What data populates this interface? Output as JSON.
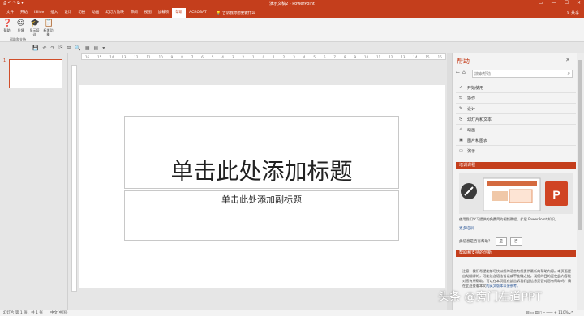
{
  "colors": {
    "accent": "#c43e1c",
    "link": "#2b5797"
  },
  "titlebar": {
    "title": "演示文稿2 - PowerPoint",
    "qat": "⎙ ↶ ↷ ⧉ ▾",
    "controls": [
      "▭",
      "—",
      "☐",
      "✕"
    ]
  },
  "tabs": [
    "文件",
    "开始",
    "iSlide",
    "插入",
    "设计",
    "切换",
    "动画",
    "幻灯片放映",
    "审阅",
    "视图",
    "加载项",
    "帮助",
    "ACROBAT"
  ],
  "active_tab_index": 11,
  "tellme": {
    "icon": "lightbulb-icon",
    "label": "告诉我你想要做什么"
  },
  "share": "⇪ 共享",
  "ribbon": {
    "buttons": [
      {
        "icon": "help-icon",
        "glyph": "❓",
        "label": "帮助"
      },
      {
        "icon": "feedback-icon",
        "glyph": "☺",
        "label": "反馈"
      },
      {
        "icon": "training-icon",
        "glyph": "🎓",
        "label": "显示培训"
      },
      {
        "icon": "whatsnew-icon",
        "glyph": "📋",
        "label": "新增功能"
      }
    ],
    "group_label": "帮助和支持"
  },
  "quick_access": [
    "💾",
    "↶",
    "↷",
    "⎘",
    "⊞",
    "🔍",
    "▦",
    "▤",
    "▾"
  ],
  "ruler_ticks": [
    "16",
    "15",
    "14",
    "13",
    "12",
    "11",
    "10",
    "9",
    "8",
    "7",
    "6",
    "5",
    "4",
    "3",
    "2",
    "1",
    "0",
    "1",
    "2",
    "3",
    "4",
    "5",
    "6",
    "7",
    "8",
    "9",
    "10",
    "11",
    "12",
    "13",
    "14",
    "15",
    "16"
  ],
  "thumbnail": {
    "number": "1"
  },
  "slide": {
    "title_placeholder": "单击此处添加标题",
    "subtitle_placeholder": "单击此处添加副标题"
  },
  "help": {
    "title": "帮助",
    "close": "✕",
    "nav_back": "←",
    "nav_home": "⌂",
    "search_placeholder": "搜索帮助",
    "items": [
      {
        "icon": "checkmark-icon",
        "glyph": "✓",
        "label": "开始使用"
      },
      {
        "icon": "handshake-icon",
        "glyph": "⇆",
        "label": "协作"
      },
      {
        "icon": "pen-icon",
        "glyph": "✎",
        "label": "设计"
      },
      {
        "icon": "slide-text-icon",
        "glyph": "⎘",
        "label": "幻灯片和文本"
      },
      {
        "icon": "animation-icon",
        "glyph": "✧",
        "label": "动画"
      },
      {
        "icon": "picture-icon",
        "glyph": "▣",
        "label": "图片和图表"
      },
      {
        "icon": "present-icon",
        "glyph": "▭",
        "label": "演示"
      }
    ],
    "training_header": "培训课程",
    "training_text": "使用我们学习提供的免费简约视频教程，扩展 PowerPoint 知识。",
    "training_link": "更多培训",
    "feedback_q": "此信息是否有帮助？",
    "feedback_yes": "是",
    "feedback_no": "否",
    "news_header": "帮助和支持的创新",
    "news_text": "注意：我们希望能够尽快以您的语言为您提供最新的帮助内容。本页面是自动翻译的，可能包含语法错误或不准确之处。我们的目的是使此内容能对您有所帮助。可以在本页面底部告诉我们此信息是否对您有帮助吗？请在此处查看本文",
    "news_link": "的英文版本以便参考。"
  },
  "status": {
    "slide": "幻灯片 第 1 张，共 1 张",
    "language": "中文(中国)",
    "zoom": "⊟ ▭ ▤ ▯ ─ ─── + 110%  ⤢"
  },
  "watermark": "头条 @旁门左道PPT"
}
